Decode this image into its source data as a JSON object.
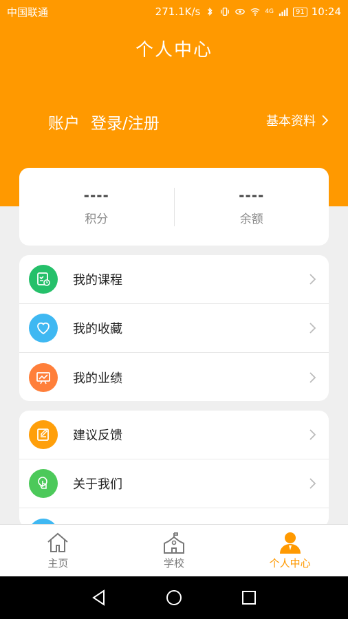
{
  "status_bar": {
    "carrier": "中国联通",
    "speed": "271.1K/s",
    "network": "4G",
    "battery": "91",
    "time": "10:24"
  },
  "header": {
    "title": "个人中心",
    "account_label": "账户",
    "login_label": "登录/注册",
    "profile_link": "基本资料",
    "background_color": "#ff9900"
  },
  "stats": [
    {
      "value": "----",
      "label": "积分"
    },
    {
      "value": "----",
      "label": "余额"
    }
  ],
  "menu_group_1": [
    {
      "label": "我的课程",
      "icon": "course-icon",
      "color": "#25c06a"
    },
    {
      "label": "我的收藏",
      "icon": "heart-icon",
      "color": "#3fb8f2"
    },
    {
      "label": "我的业绩",
      "icon": "chart-board-icon",
      "color": "#ff7f3a"
    }
  ],
  "menu_group_2": [
    {
      "label": "建议反馈",
      "icon": "feedback-icon",
      "color": "#ff9f0a"
    },
    {
      "label": "关于我们",
      "icon": "touch-icon",
      "color": "#4cc95a"
    },
    {
      "label": "",
      "icon": "partial-icon",
      "color": "#3fb8f2"
    }
  ],
  "tabs": [
    {
      "label": "主页",
      "icon": "home-icon",
      "active": false
    },
    {
      "label": "学校",
      "icon": "school-icon",
      "active": false
    },
    {
      "label": "个人中心",
      "icon": "user-icon",
      "active": true
    }
  ],
  "accent_color": "#ff9900"
}
